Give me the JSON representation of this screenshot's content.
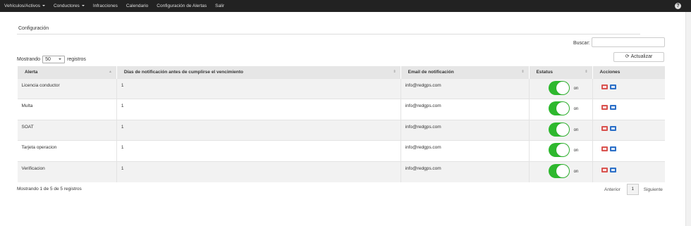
{
  "nav": {
    "items": [
      {
        "label": "Vehículos/Activos",
        "dropdown": true
      },
      {
        "label": "Conductores",
        "dropdown": true
      },
      {
        "label": "Infracciones",
        "dropdown": false
      },
      {
        "label": "Calendario",
        "dropdown": false
      },
      {
        "label": "Configuración de Alertas",
        "dropdown": false
      },
      {
        "label": "Salir",
        "dropdown": false
      }
    ],
    "help_icon": "question-circle-icon"
  },
  "page": {
    "title": "Configuración",
    "search_label": "Buscar:",
    "search_value": "",
    "length_prefix": "Mostrando",
    "length_value": "50",
    "length_suffix": "registros",
    "refresh_label": "Actualizar",
    "refresh_icon": "refresh-icon"
  },
  "table": {
    "columns": [
      "Alerta",
      "Días de notificación antes de cumplirse el vencimiento",
      "Email de notificación",
      "Estatus",
      "Acciones"
    ],
    "rows": [
      {
        "alerta": "Licencia conductor",
        "dias": "1",
        "email": "info@redgps.com",
        "estatus": "on"
      },
      {
        "alerta": "Multa",
        "dias": "1",
        "email": "info@redgps.com",
        "estatus": "on"
      },
      {
        "alerta": "SOAT",
        "dias": "1",
        "email": "info@redgps.com",
        "estatus": "on"
      },
      {
        "alerta": "Tarjeta operacion",
        "dias": "1",
        "email": "info@redgps.com",
        "estatus": "on"
      },
      {
        "alerta": "Verificacion",
        "dias": "1",
        "email": "info@redgps.com",
        "estatus": "on"
      }
    ]
  },
  "footer": {
    "info": "Mostrando 1 de 5 de 5 registros",
    "prev": "Anterior",
    "page": "1",
    "next": "Siguiente"
  },
  "colors": {
    "toggle_on": "#2eb82e",
    "delete": "#d9534f",
    "email": "#2b6fc7",
    "navbar": "#222222"
  }
}
